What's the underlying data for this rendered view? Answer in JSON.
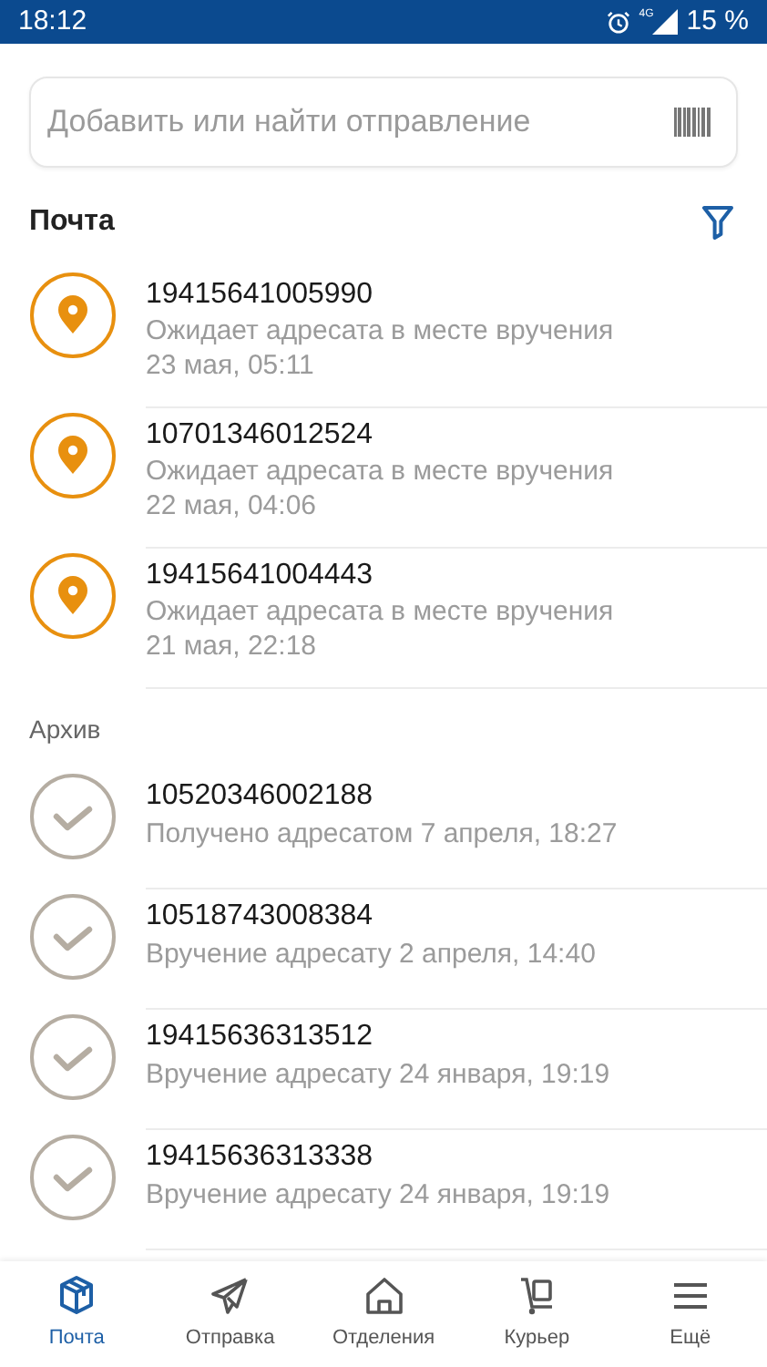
{
  "status_bar": {
    "time": "18:12",
    "network": "4G",
    "battery": "15 %"
  },
  "search": {
    "placeholder": "Добавить или найти отправление"
  },
  "section": {
    "title": "Почта"
  },
  "items": [
    {
      "kind": "waiting",
      "number": "19415641005990",
      "lines": [
        "Ожидает адресата в месте вручения",
        "23 мая, 05:11"
      ]
    },
    {
      "kind": "waiting",
      "number": "10701346012524",
      "lines": [
        "Ожидает адресата в месте вручения",
        "22 мая, 04:06"
      ]
    },
    {
      "kind": "waiting",
      "number": "19415641004443",
      "lines": [
        "Ожидает адресата в месте вручения",
        "21 мая, 22:18"
      ]
    }
  ],
  "archive": {
    "title": "Архив",
    "items": [
      {
        "kind": "delivered",
        "number": "10520346002188",
        "lines": [
          "Получено адресатом 7 апреля, 18:27"
        ]
      },
      {
        "kind": "delivered",
        "number": "10518743008384",
        "lines": [
          "Вручение адресату 2 апреля, 14:40"
        ]
      },
      {
        "kind": "delivered",
        "number": "19415636313512",
        "lines": [
          "Вручение адресату 24 января, 19:19"
        ]
      },
      {
        "kind": "delivered",
        "number": "19415636313338",
        "lines": [
          "Вручение адресату 24 января, 19:19"
        ]
      }
    ]
  },
  "nav": [
    {
      "kind": "box",
      "label": "Почта",
      "selected": true
    },
    {
      "kind": "plane",
      "label": "Отправка",
      "selected": false
    },
    {
      "kind": "house",
      "label": "Отделения",
      "selected": false
    },
    {
      "kind": "courier",
      "label": "Курьер",
      "selected": false
    },
    {
      "kind": "menu",
      "label": "Ещё",
      "selected": false
    }
  ]
}
